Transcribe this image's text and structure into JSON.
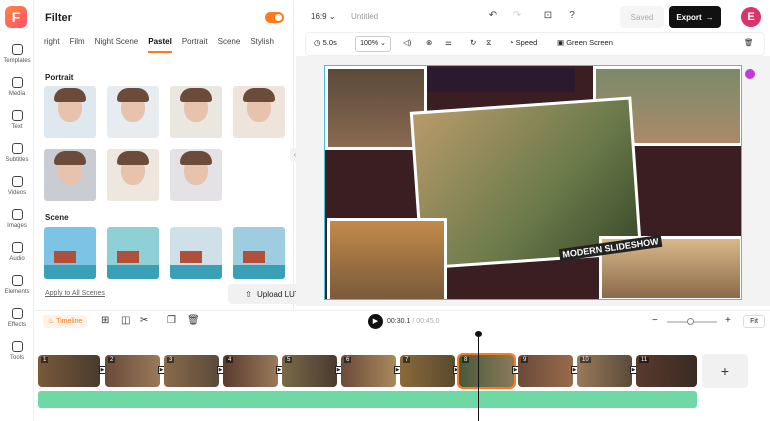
{
  "app": {
    "logo_letter": "F"
  },
  "sidebar": {
    "items": [
      {
        "label": "Templates",
        "icon": "templates-icon"
      },
      {
        "label": "Media",
        "icon": "media-icon"
      },
      {
        "label": "Text",
        "icon": "text-icon"
      },
      {
        "label": "Subtitles",
        "icon": "subtitles-icon"
      },
      {
        "label": "Videos",
        "icon": "videos-icon"
      },
      {
        "label": "Images",
        "icon": "images-icon"
      },
      {
        "label": "Audio",
        "icon": "audio-icon"
      },
      {
        "label": "Elements",
        "icon": "elements-icon"
      },
      {
        "label": "Effects",
        "icon": "effects-icon"
      },
      {
        "label": "Tools",
        "icon": "tools-icon"
      }
    ]
  },
  "filter_panel": {
    "title": "Filter",
    "toggle_on": true,
    "tabs": [
      "right",
      "Film",
      "Night Scene",
      "Pastel",
      "Portrait",
      "Scene",
      "Stylish"
    ],
    "active_tab": "Pastel",
    "sections": [
      {
        "label": "Portrait",
        "count": 7
      },
      {
        "label": "Scene",
        "count": 4
      }
    ],
    "apply_all_label": "Apply to All Scenes",
    "upload_label": "Upload LUT"
  },
  "topbar": {
    "aspect_ratio": "16:9",
    "project_name": "Untitled",
    "saved_label": "Saved",
    "export_label": "Export",
    "avatar_letter": "E"
  },
  "editbar": {
    "duration": "5.0s",
    "zoom": "100%",
    "speed_label": "Speed",
    "green_screen_label": "Green Screen"
  },
  "canvas": {
    "slide_title": "MODERN SLIDESHOW",
    "accent_color": "#45c2d8"
  },
  "timeline": {
    "label": "Timeline",
    "current_time": "00:30.1",
    "total_time": "00:45.0",
    "fit_label": "Fit",
    "clips": [
      "1",
      "2",
      "3",
      "4",
      "5",
      "6",
      "7",
      "8",
      "9",
      "10",
      "11"
    ],
    "add_label": "+"
  },
  "colors": {
    "accent": "#ff7a1a",
    "audio": "#6ed9a5",
    "export_bg": "#111111"
  }
}
